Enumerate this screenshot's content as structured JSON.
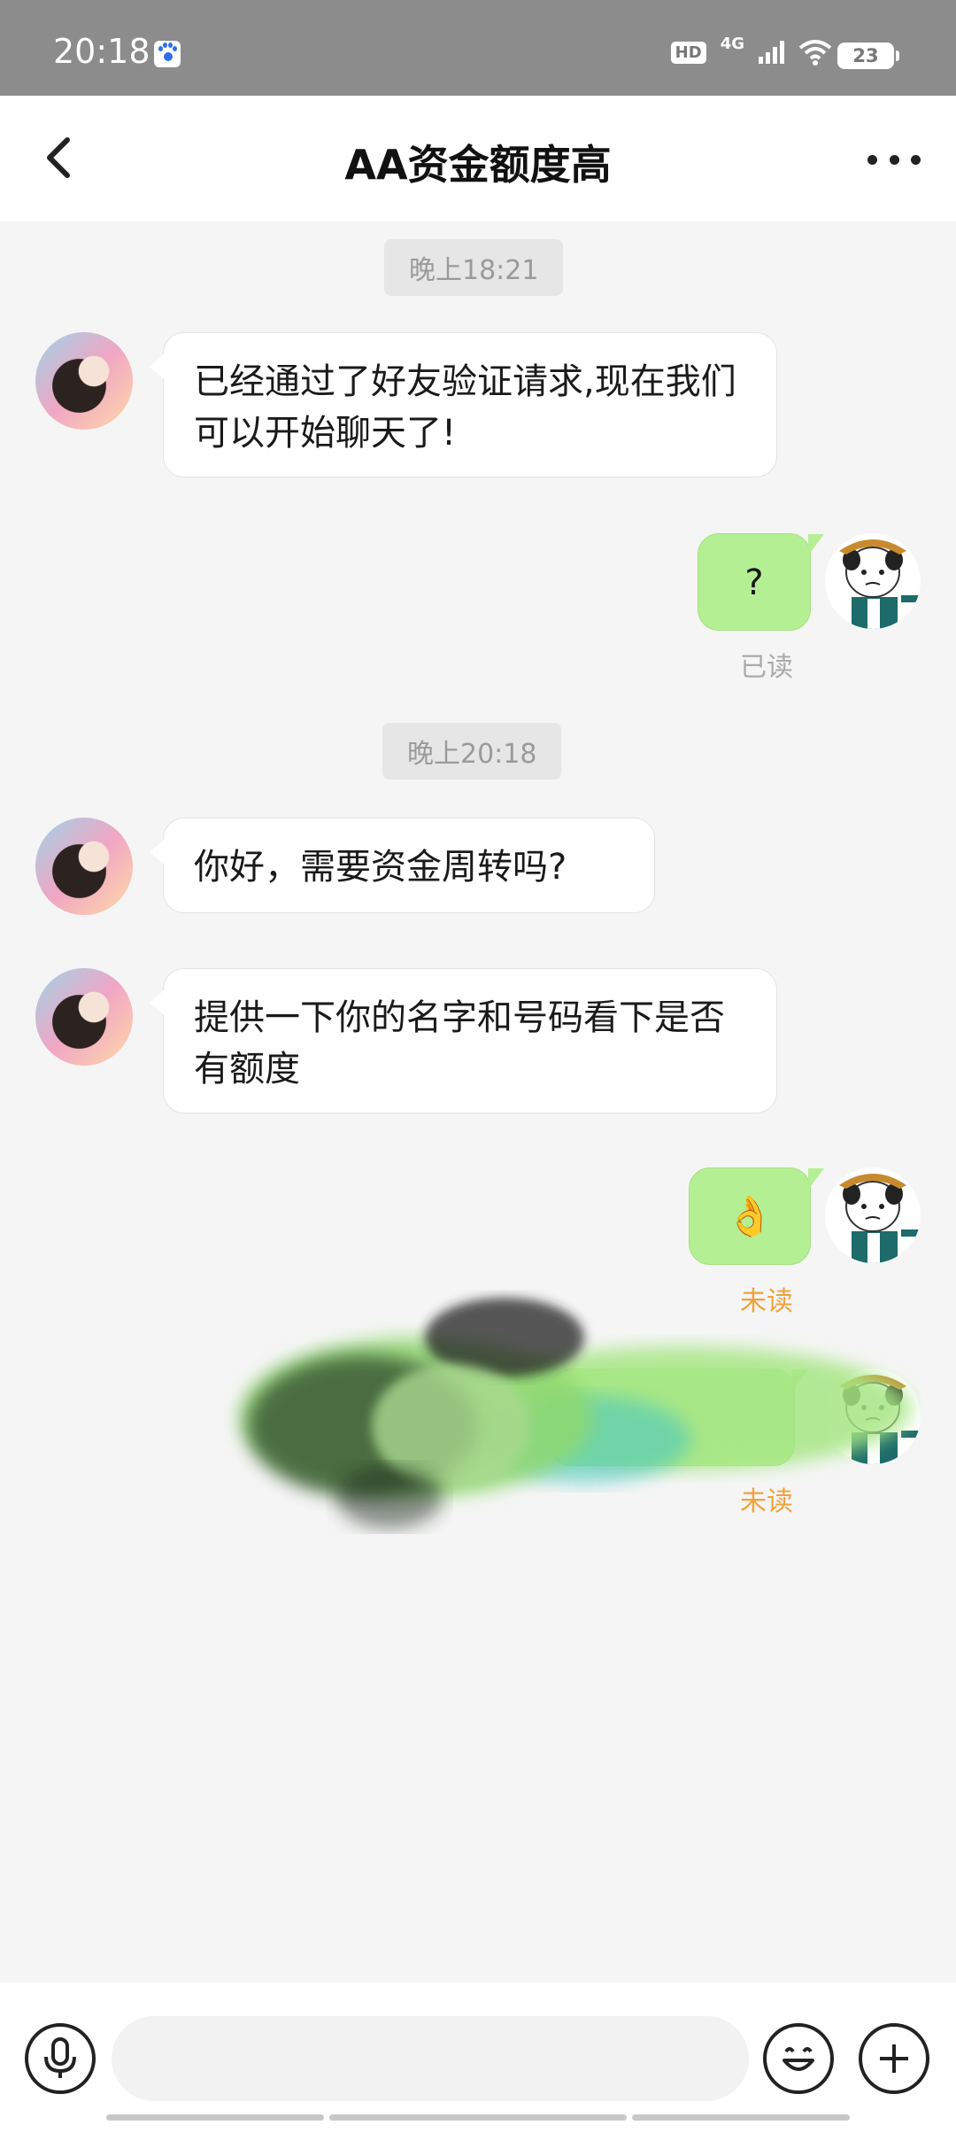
{
  "status_bar": {
    "time": "20:18",
    "hd": "HD",
    "network": "4G",
    "battery": "23"
  },
  "header": {
    "title": "AA资金额度高"
  },
  "chat": {
    "time_1": "晚上18:21",
    "time_2": "晚上20:18",
    "msg_1": "已经通过了好友验证请求,现在我们可以开始聊天了!",
    "msg_2": "?",
    "msg_2_status": "已读",
    "msg_3": "你好，需要资金周转吗?",
    "msg_4": "提供一下你的名字和号码看下是否有额度",
    "msg_5": "👌",
    "msg_5_status": "未读",
    "msg_6_status": "未读"
  },
  "input": {
    "placeholder": ""
  },
  "colors": {
    "mine_bubble": "#b5ef94",
    "unread": "#f0a23c",
    "status_bar": "#8c8c8c"
  },
  "icons": [
    "back-icon",
    "more-icon",
    "microphone-icon",
    "emoji-icon",
    "plus-icon"
  ]
}
